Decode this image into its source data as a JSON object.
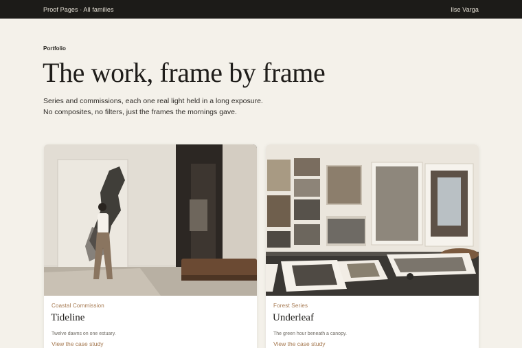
{
  "header": {
    "breadcrumb": "Proof Pages · All families",
    "user_name": "Ilse Varga"
  },
  "hero": {
    "eyebrow": "Portfolio",
    "title": "The work, frame by frame",
    "lede": "Series and commissions, each one real light held in a long exposure. No composites, no filters, just the frames the mornings gave."
  },
  "cards": [
    {
      "category": "Coastal Commission",
      "title": "Tideline",
      "description": "Twelve dawns on one estuary.",
      "link": "View the case study"
    },
    {
      "category": "Forest Series",
      "title": "Underleaf",
      "description": "The green hour beneath a canopy.",
      "link": "View the case study"
    }
  ],
  "colors": {
    "accent": "#a4774e",
    "topbar": "#1c1b18",
    "page": "#f4f1ea"
  }
}
